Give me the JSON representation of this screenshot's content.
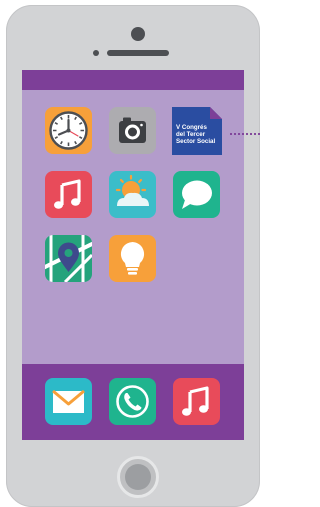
{
  "phone": {
    "frame_color": "#d2d3d5",
    "screen_color": "#b39ccb",
    "bar_color": "#7d3f98"
  },
  "home_apps": [
    {
      "name": "clock",
      "icon": "clock-icon",
      "color": "#f7a03a"
    },
    {
      "name": "camera",
      "icon": "camera-icon",
      "color": "#adacb0"
    },
    {
      "name": "notice",
      "icon": "document-icon",
      "color": "#2a4da1"
    },
    {
      "name": "music",
      "icon": "music-note-icon",
      "color": "#e84b5a"
    },
    {
      "name": "weather",
      "icon": "sun-cloud-icon",
      "color": "#3bbdc9"
    },
    {
      "name": "messages",
      "icon": "chat-bubble-icon",
      "color": "#1fb48e"
    },
    {
      "name": "maps",
      "icon": "map-pin-icon",
      "color": "#25a37c"
    },
    {
      "name": "ideas",
      "icon": "lightbulb-icon",
      "color": "#f7a03a"
    }
  ],
  "dock_apps": [
    {
      "name": "mail",
      "icon": "envelope-icon",
      "color": "#2cbac8"
    },
    {
      "name": "phone",
      "icon": "phone-handset-icon",
      "color": "#1fb48e"
    },
    {
      "name": "music",
      "icon": "music-note-icon",
      "color": "#e84b5a"
    }
  ],
  "notice": {
    "line1": "V Congrés",
    "line2": "del Tercer",
    "line3": "Sector Social"
  }
}
